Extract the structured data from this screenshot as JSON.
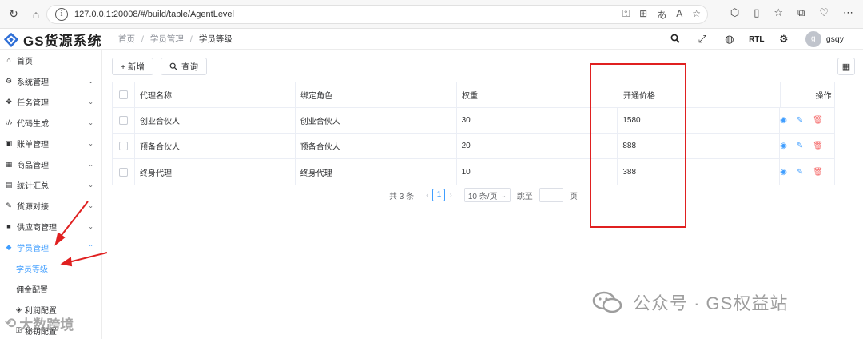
{
  "browser": {
    "url": "127.0.0.1:20008/#/build/table/AgentLevel",
    "reload_icon": "reload-icon",
    "home_icon": "home-icon"
  },
  "app": {
    "logo_text": "GS货源系统",
    "breadcrumb": [
      "首页",
      "学员管理",
      "学员等级"
    ],
    "header": {
      "rtl_label": "RTL",
      "avatar_initial": "g",
      "username": "gsqy"
    }
  },
  "sidebar": {
    "items": [
      {
        "label": "首页",
        "icon": "home-icon",
        "arrow": ""
      },
      {
        "label": "系统管理",
        "icon": "gears-icon",
        "arrow": "⌄"
      },
      {
        "label": "任务管理",
        "icon": "task-icon",
        "arrow": "⌄"
      },
      {
        "label": "代码生成",
        "icon": "code-icon",
        "arrow": "⌄"
      },
      {
        "label": "账单管理",
        "icon": "bill-icon",
        "arrow": "⌄"
      },
      {
        "label": "商品管理",
        "icon": "calendar-icon",
        "arrow": "⌄"
      },
      {
        "label": "统计汇总",
        "icon": "table-icon",
        "arrow": "⌄"
      },
      {
        "label": "货源对接",
        "icon": "plug-icon",
        "arrow": "⌄"
      },
      {
        "label": "供应商管理",
        "icon": "box-icon",
        "arrow": "⌄"
      },
      {
        "label": "学员管理",
        "icon": "diamond-icon",
        "arrow": "⌃"
      }
    ],
    "subitems": [
      {
        "label": "学员等级"
      },
      {
        "label": "佣金配置"
      },
      {
        "label": "利润配置"
      },
      {
        "label": "秘钥配置"
      }
    ]
  },
  "toolbar": {
    "add_label": "+ 新增",
    "query_label": "查询"
  },
  "table": {
    "headers": [
      "代理名称",
      "绑定角色",
      "权重",
      "开通价格",
      "操作"
    ],
    "rows": [
      {
        "name": "创业合伙人",
        "role": "创业合伙人",
        "weight": "30",
        "price": "1580"
      },
      {
        "name": "预备合伙人",
        "role": "预备合伙人",
        "weight": "20",
        "price": "888"
      },
      {
        "name": "终身代理",
        "role": "终身代理",
        "weight": "10",
        "price": "388"
      }
    ]
  },
  "pagination": {
    "total": "共 3 条",
    "current": "1",
    "page_size": "10 条/页",
    "jump_label": "跳至",
    "page_label": "页"
  },
  "watermark": {
    "right_text": "公众号 · GS权益站",
    "left_text": "大数跨境"
  },
  "colors": {
    "accent": "#409eff",
    "danger": "#f56c6c",
    "annotation": "#e02020"
  }
}
